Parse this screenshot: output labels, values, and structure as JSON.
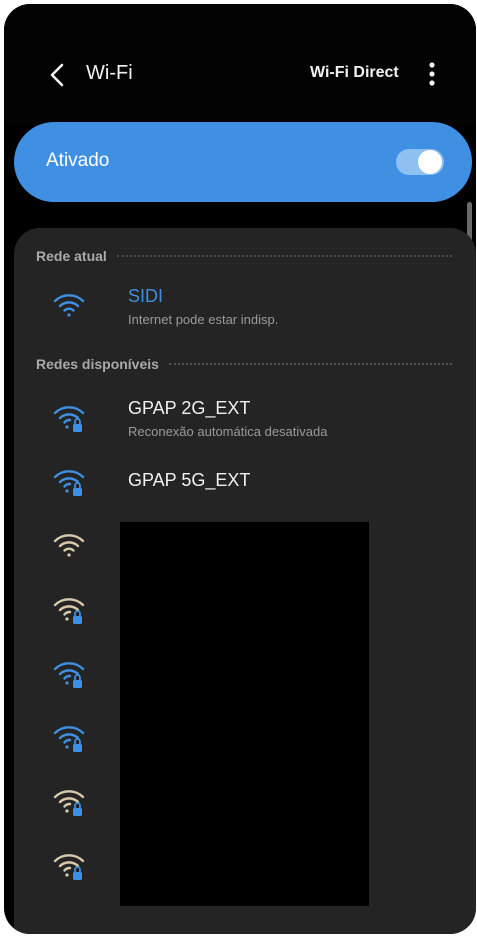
{
  "header": {
    "title": "Wi-Fi",
    "wifi_direct_label": "Wi-Fi Direct"
  },
  "toggle": {
    "label": "Ativado",
    "state": "on",
    "accent_color": "#3f8fe3"
  },
  "sections": {
    "current": "Rede atual",
    "available": "Redes disponíveis"
  },
  "current_network": {
    "name": "SIDI",
    "status": "Internet pode estar indisp.",
    "name_color": "#3f8fe3",
    "icon": "wifi-icon"
  },
  "available_networks": [
    {
      "name": "GPAP 2G_EXT",
      "status": "Reconexão automática desativada",
      "icon": "wifi-lock-icon",
      "icon_color": "#3f8fe3"
    },
    {
      "name": "GPAP 5G_EXT",
      "status": "",
      "icon": "wifi-lock-icon",
      "icon_color": "#3f8fe3"
    },
    {
      "name": "",
      "status": "",
      "icon": "wifi-icon",
      "icon_color": "#d8c9ad"
    },
    {
      "name": "",
      "status": "",
      "icon": "wifi-lock-icon",
      "icon_color": "#d8c9ad"
    },
    {
      "name": "",
      "status": "",
      "icon": "wifi-lock-icon",
      "icon_color": "#3f8fe3"
    },
    {
      "name": "",
      "status": "",
      "icon": "wifi-lock-icon",
      "icon_color": "#3f8fe3"
    },
    {
      "name": "",
      "status": "",
      "icon": "wifi-lock-icon",
      "icon_color": "#d8c9ad"
    },
    {
      "name": "",
      "status": "",
      "icon": "wifi-lock-icon",
      "icon_color": "#d8c9ad"
    }
  ]
}
